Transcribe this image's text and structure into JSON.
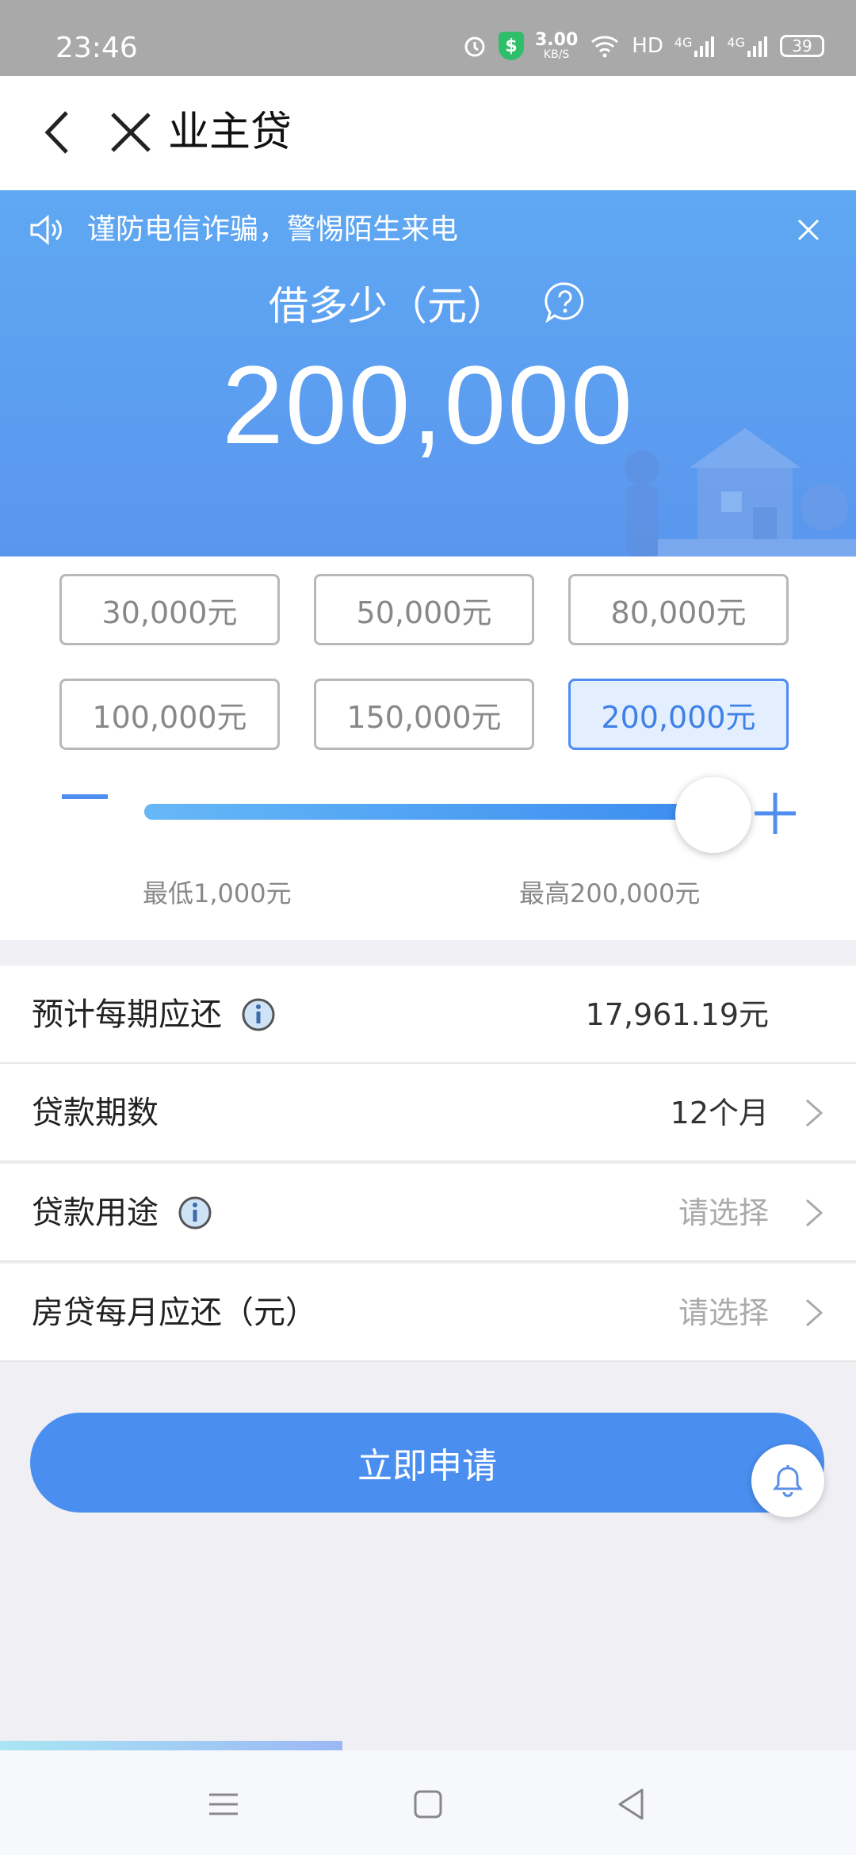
{
  "status_bar": {
    "time": "23:46",
    "net_speed_value": "3.00",
    "net_speed_unit": "KB/S",
    "hd_label": "HD",
    "signal_1_label": "4G",
    "signal_2_label": "4G",
    "battery": "39"
  },
  "nav": {
    "title": "业主贷"
  },
  "notice": {
    "text": "谨防电信诈骗，警惕陌生来电"
  },
  "loan": {
    "label": "借多少（元）",
    "amount": "200,000",
    "options": [
      {
        "label": "30,000元",
        "selected": false
      },
      {
        "label": "50,000元",
        "selected": false
      },
      {
        "label": "80,000元",
        "selected": false
      },
      {
        "label": "100,000元",
        "selected": false
      },
      {
        "label": "150,000元",
        "selected": false
      },
      {
        "label": "200,000元",
        "selected": true
      }
    ],
    "slider": {
      "min_label": "最低1,000元",
      "max_label": "最高200,000元",
      "level": 1.0
    }
  },
  "form": {
    "monthly_payment": {
      "label": "预计每期应还",
      "value": "17,961.19元"
    },
    "term": {
      "label": "贷款期数",
      "value": "12个月"
    },
    "purpose": {
      "label": "贷款用途",
      "value": "请选择"
    },
    "mortgage": {
      "label": "房贷每月应还（元）",
      "value": "请选择"
    }
  },
  "actions": {
    "apply_label": "立即申请"
  },
  "colors": {
    "accent": "#4a8ff0",
    "hero_top": "#5fa8f3",
    "hero_bottom": "#5a96ee",
    "selected_bg": "#e3efff"
  },
  "icons": [
    "back-icon",
    "close-icon",
    "speaker-icon",
    "help-icon",
    "info-icon",
    "chevron-right-icon",
    "bell-icon",
    "menu-icon",
    "home-icon",
    "back-triangle-icon"
  ]
}
